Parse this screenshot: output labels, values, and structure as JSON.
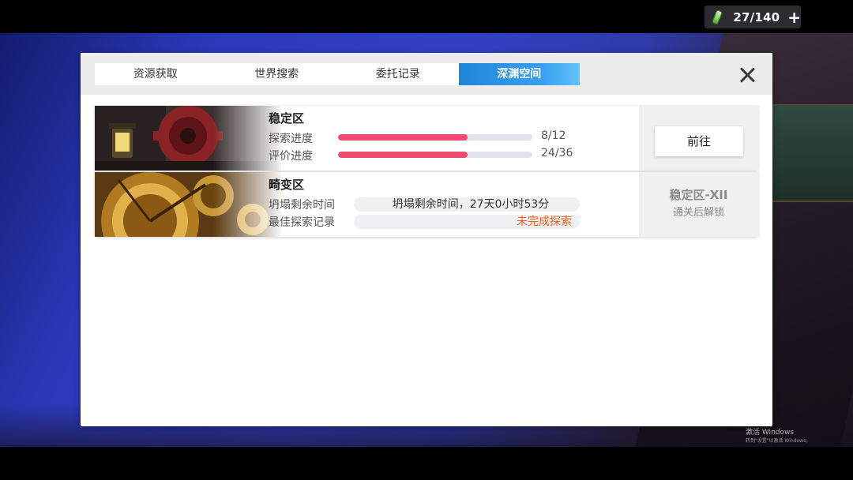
{
  "hud": {
    "stamina": "27/140",
    "add_symbol": "+"
  },
  "tabs": [
    {
      "label": "资源获取",
      "active": false
    },
    {
      "label": "世界搜索",
      "active": false
    },
    {
      "label": "委托记录",
      "active": false
    },
    {
      "label": "深渊空间",
      "active": true
    }
  ],
  "zones": [
    {
      "title": "稳定区",
      "explore_label": "探索进度",
      "explore_value": "8/12",
      "explore_ratio": 0.6667,
      "rating_label": "评价进度",
      "rating_value": "24/36",
      "rating_ratio": 0.6667,
      "action_label": "前往"
    },
    {
      "title": "畸变区",
      "collapse_label": "坍塌剩余时间",
      "collapse_value": "坍塌剩余时间，27天0小时53分",
      "best_label": "最佳探索记录",
      "best_value": "未完成探索",
      "lock_title": "稳定区-XII",
      "lock_subtitle": "通关后解锁"
    }
  ],
  "colors": {
    "progress": "#f04a6f",
    "tab_active": "#2b95e6",
    "record_text": "#f0601a"
  },
  "watermark": {
    "line1": "激活 Windows",
    "line2": "转到\"设置\"以激活 Windows。"
  }
}
